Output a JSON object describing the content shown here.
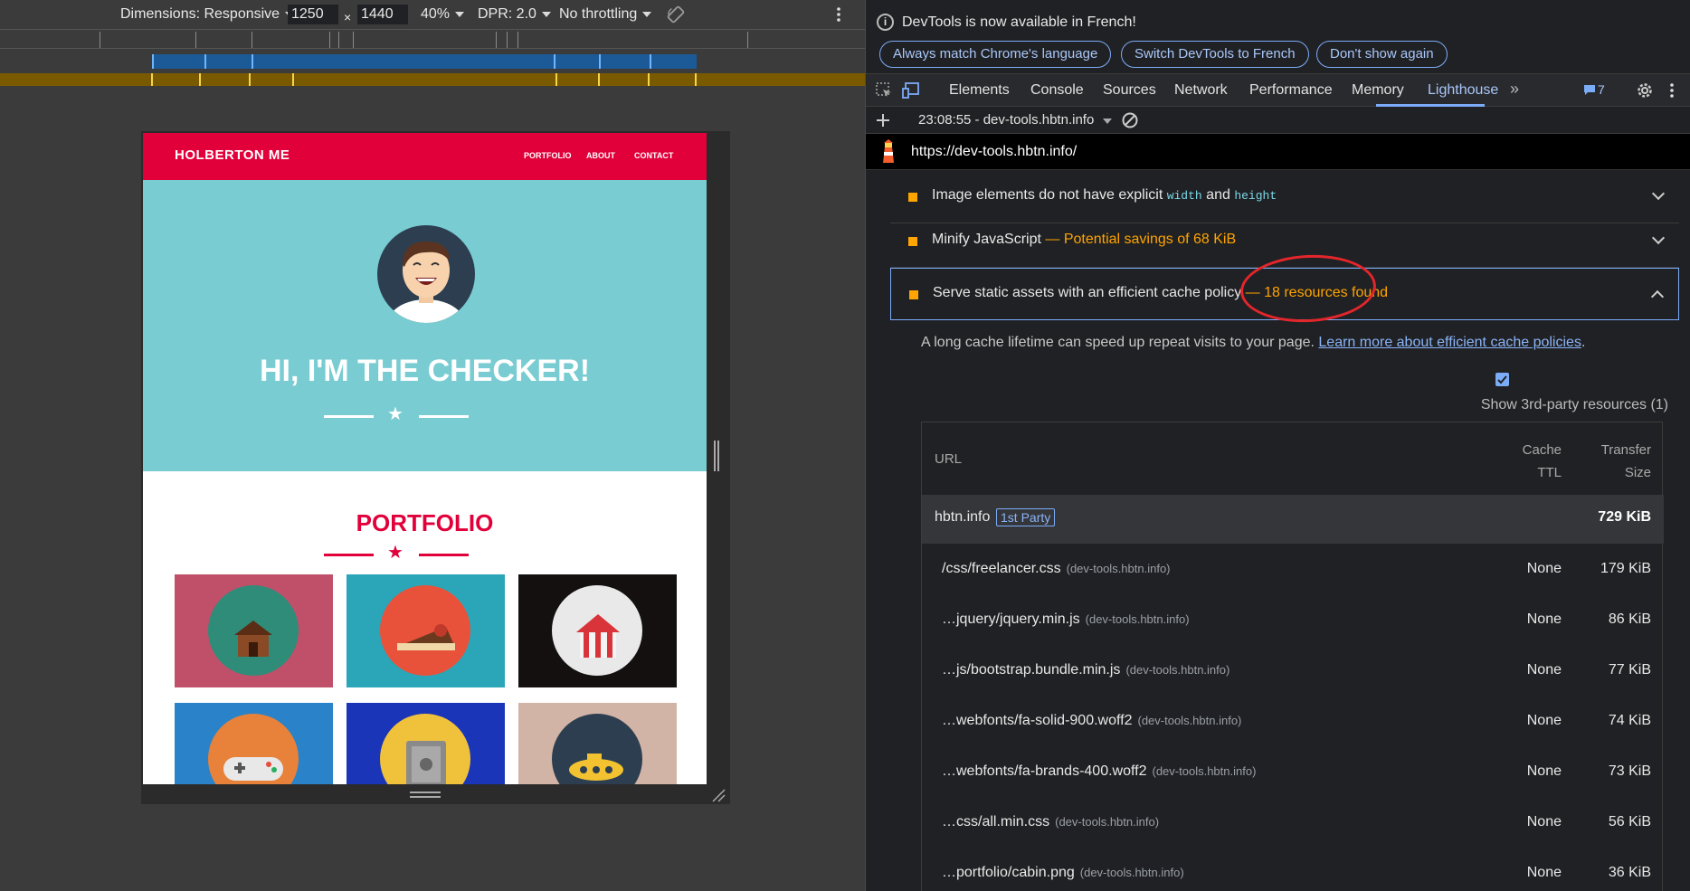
{
  "device_toolbar": {
    "dimensions_label": "Dimensions: Responsive",
    "width_value": "1250",
    "times": "×",
    "height_value": "1440",
    "zoom": "40%",
    "dpr": "DPR: 2.0",
    "throttling": "No throttling"
  },
  "site": {
    "brand": "HOLBERTON ME",
    "nav": [
      "PORTFOLIO",
      "ABOUT",
      "CONTACT"
    ],
    "hero_title": "HI, I'M THE CHECKER!",
    "portfolio_title": "PORTFOLIO",
    "colors": {
      "primary": "#e1003a",
      "hero": "#78ccd2"
    }
  },
  "devtools": {
    "info_message": "DevTools is now available in French!",
    "info_buttons": [
      "Always match Chrome's language",
      "Switch DevTools to French",
      "Don't show again"
    ],
    "tabs": [
      "Elements",
      "Console",
      "Sources",
      "Network",
      "Performance",
      "Memory",
      "Lighthouse"
    ],
    "active_tab": "Lighthouse",
    "issues_count": "7",
    "report_selector": "23:08:55 - dev-tools.hbtn.info",
    "report_url": "https://dev-tools.hbtn.info/"
  },
  "audits": {
    "a1": {
      "title_pre": "Image elements do not have explicit ",
      "code1": "width",
      "mid": " and ",
      "code2": "height"
    },
    "a2": {
      "title": "Minify JavaScript",
      "savings": "— Potential savings of 68 KiB"
    },
    "a3": {
      "title": "Serve static assets with an efficient cache policy",
      "savings": "— 18 resources found"
    }
  },
  "cache_detail": {
    "description": "A long cache lifetime can speed up repeat visits to your page.",
    "learn_more": "Learn more about efficient cache policies",
    "period": ".",
    "third_party_label": "Show 3rd-party resources (1)",
    "headers": {
      "url": "URL",
      "ttl_1": "Cache",
      "ttl_2": "TTL",
      "size_1": "Transfer",
      "size_2": "Size"
    },
    "group": {
      "name": "hbtn.info",
      "badge": "1st Party",
      "size": "729 KiB"
    },
    "rows": [
      {
        "url": "/css/freelancer.css",
        "host": "(dev-tools.hbtn.info)",
        "ttl": "None",
        "size": "179 KiB"
      },
      {
        "url": "…jquery/jquery.min.js",
        "host": "(dev-tools.hbtn.info)",
        "ttl": "None",
        "size": "86 KiB"
      },
      {
        "url": "…js/bootstrap.bundle.min.js",
        "host": "(dev-tools.hbtn.info)",
        "ttl": "None",
        "size": "77 KiB"
      },
      {
        "url": "…webfonts/fa-solid-900.woff2",
        "host": "(dev-tools.hbtn.info)",
        "ttl": "None",
        "size": "74 KiB"
      },
      {
        "url": "…webfonts/fa-brands-400.woff2",
        "host": "(dev-tools.hbtn.info)",
        "ttl": "None",
        "size": "73 KiB"
      },
      {
        "url": "…css/all.min.css",
        "host": "(dev-tools.hbtn.info)",
        "ttl": "None",
        "size": "56 KiB"
      },
      {
        "url": "…portfolio/cabin.png",
        "host": "(dev-tools.hbtn.info)",
        "ttl": "None",
        "size": "36 KiB"
      }
    ]
  }
}
